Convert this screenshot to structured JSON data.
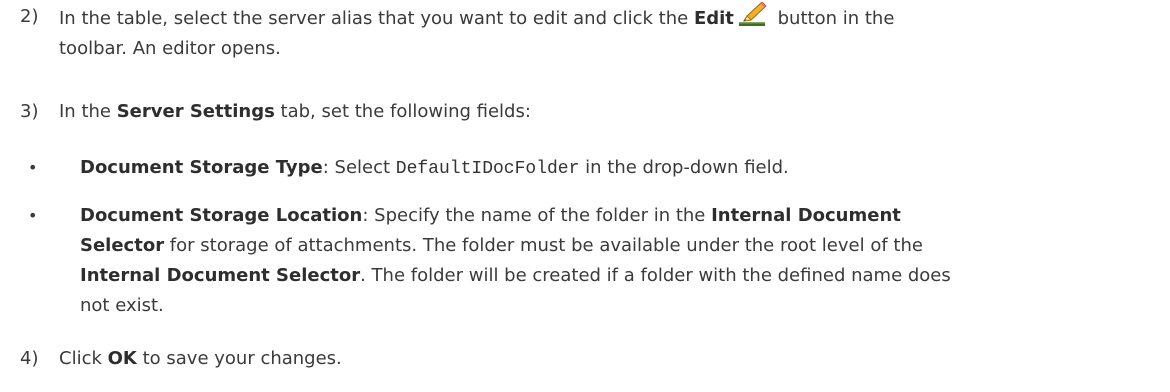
{
  "steps": [
    {
      "num": "2)",
      "pre": "In the table, select the server alias that you want to edit and click the ",
      "bold": "Edit",
      "icon": "pencil-icon",
      "post_line1": " button in the",
      "line2": "toolbar. An editor opens."
    },
    {
      "num": "3)",
      "pre": "In the ",
      "bold": "Server Settings",
      "post": " tab, set the following fields:"
    },
    {
      "num": "4)",
      "pre": "Click ",
      "bold": "OK",
      "post": " to save your changes."
    }
  ],
  "bullets": [
    {
      "marker": "•",
      "bold": "Document Storage Type",
      "pre": ": Select ",
      "code": "DefaultIDocFolder",
      "post": " in the drop-down field."
    },
    {
      "marker": "•",
      "bold1": "Document Storage Location",
      "t1": ": Specify the name of the folder in the ",
      "bold2": "Internal Document",
      "bold2b": "Selector",
      "t2": " for storage of attachments. The folder must be available under the root level of the",
      "bold3": "Internal Document Selector",
      "t3": ". The folder will be created if a folder with the defined name does",
      "t4": "not exist."
    }
  ]
}
